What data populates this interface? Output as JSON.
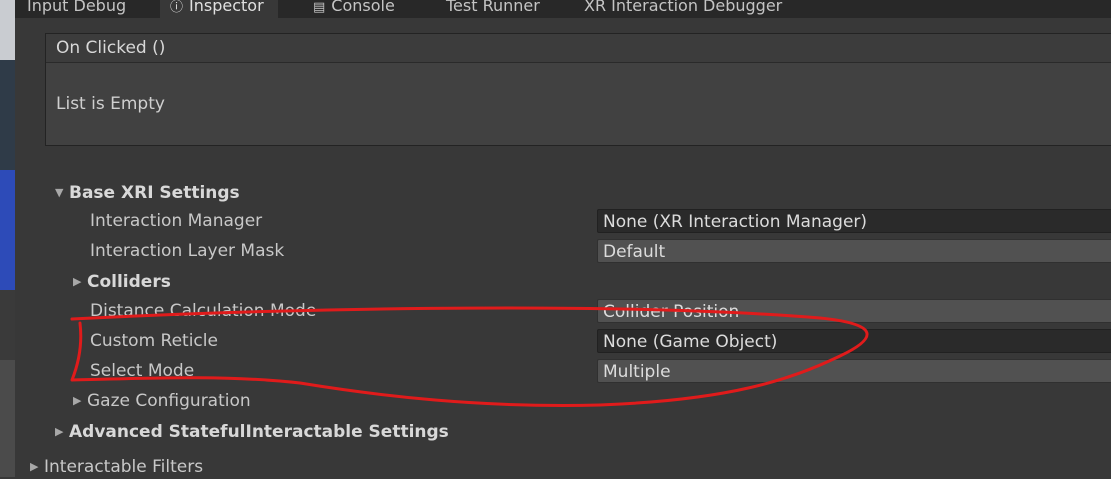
{
  "tabs": [
    {
      "label": "Input Debug"
    },
    {
      "label": "Inspector",
      "icon": "info-icon"
    },
    {
      "label": "Console",
      "icon": "console-icon"
    },
    {
      "label": "Test Runner"
    },
    {
      "label": "XR Interaction Debugger"
    }
  ],
  "event": {
    "header": "On Clicked ()",
    "empty": "List is Empty"
  },
  "base_xri": {
    "title": "Base XRI Settings",
    "interaction_manager": {
      "label": "Interaction Manager",
      "value": "None (XR Interaction Manager)"
    },
    "interaction_layer_mask": {
      "label": "Interaction Layer Mask",
      "value": "Default"
    },
    "colliders": {
      "label": "Colliders"
    },
    "distance_calc": {
      "label": "Distance Calculation Mode",
      "value": "Collider Position"
    },
    "custom_reticle": {
      "label": "Custom Reticle",
      "value": "None (Game Object)"
    },
    "select_mode": {
      "label": "Select Mode",
      "value": "Multiple"
    },
    "gaze_config": {
      "label": "Gaze Configuration"
    }
  },
  "advanced": {
    "title": "Advanced StatefulInteractable Settings"
  },
  "filters": {
    "title": "Interactable Filters"
  },
  "annotation_color": "#e01b1b"
}
